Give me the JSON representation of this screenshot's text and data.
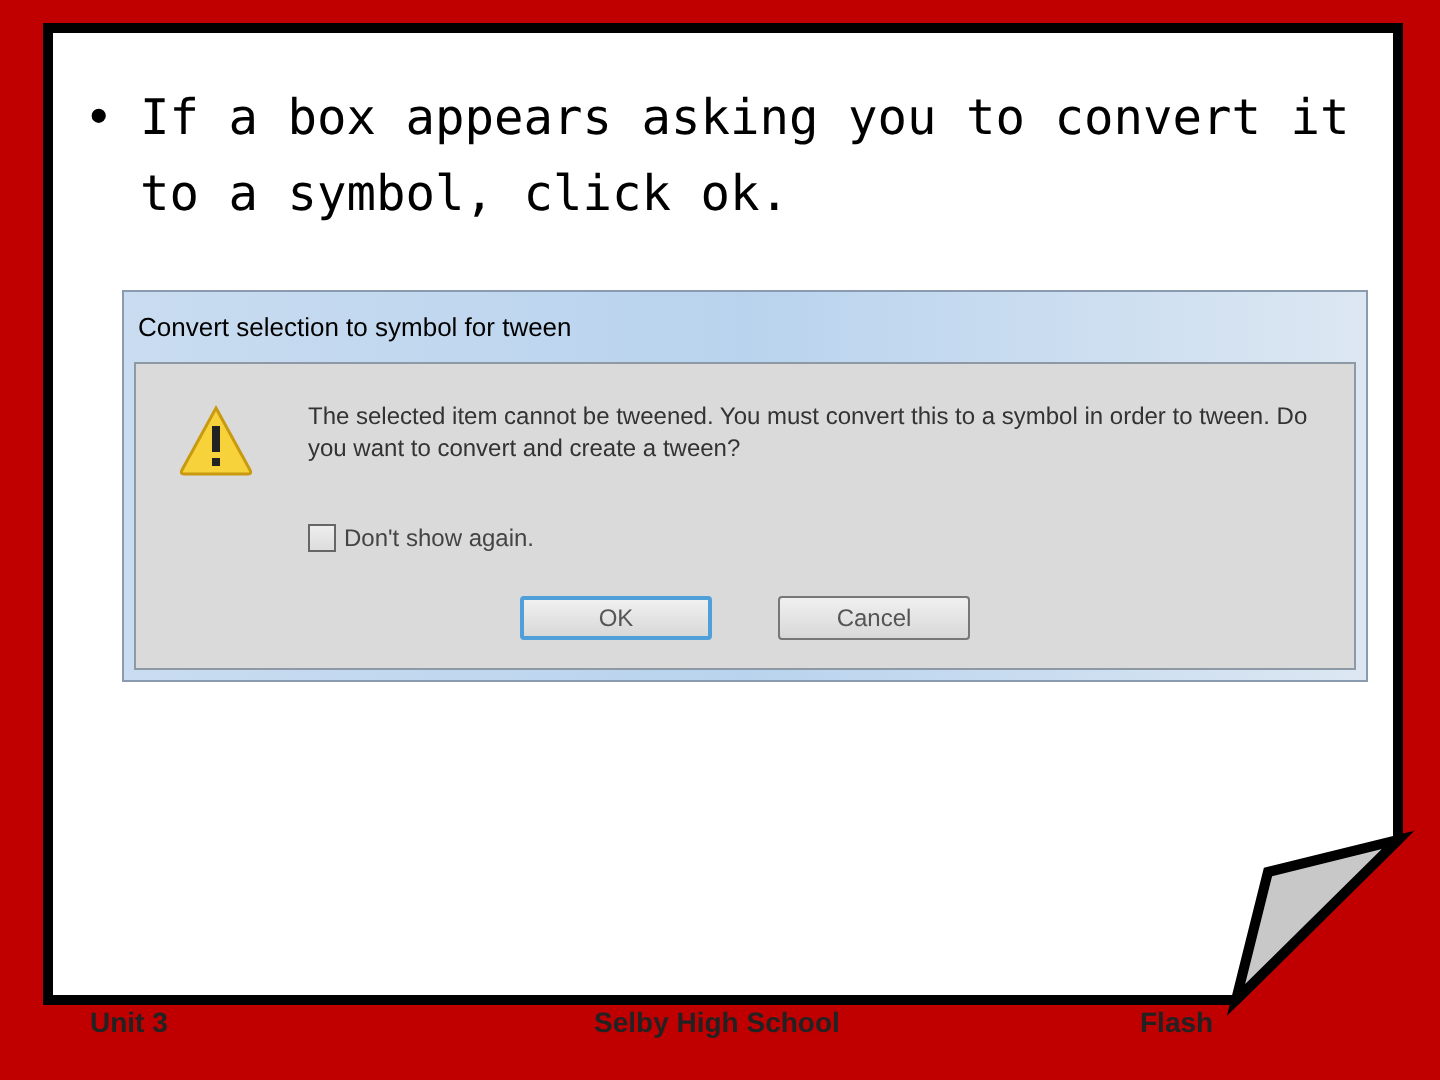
{
  "slide": {
    "bullet": "•",
    "text": "If a box appears asking you to convert it to a symbol, click ok."
  },
  "dialog": {
    "title": "Convert selection to symbol for tween",
    "message": "The selected item cannot be tweened. You must convert this to a symbol in order to tween. Do you want to convert and create a tween?",
    "checkbox": {
      "label": "Don't show again.",
      "checked": false
    },
    "buttons": [
      {
        "label": "OK",
        "default": true
      },
      {
        "label": "Cancel",
        "default": false
      }
    ]
  },
  "footer": [
    "Unit 3",
    "Selby High School",
    "Flash"
  ]
}
